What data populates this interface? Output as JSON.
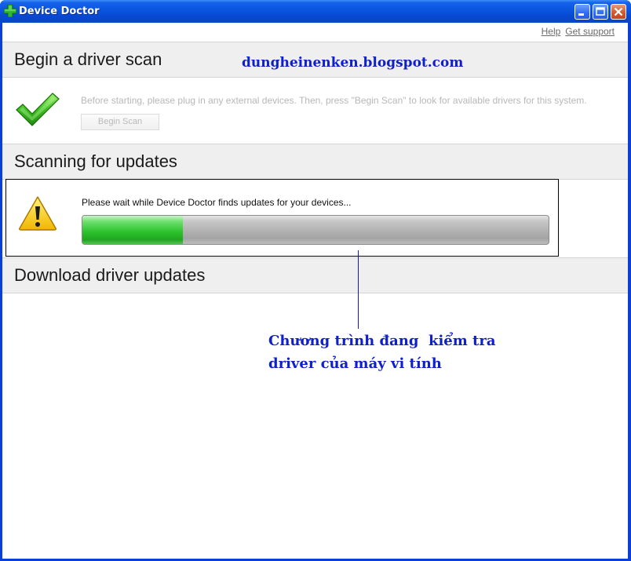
{
  "window": {
    "title": "Device Doctor"
  },
  "toplinks": {
    "help": "Help",
    "get_support": "Get support"
  },
  "watermark": "dungheinenken.blogspot.com",
  "sections": {
    "begin": {
      "title": "Begin a driver scan",
      "description": "Before starting, please plug in any external devices. Then, press \"Begin Scan\" to look for available drivers for this system.",
      "button_label": "Begin Scan"
    },
    "scanning": {
      "title": "Scanning for updates",
      "status": "Please wait while Device Doctor finds updates for your devices...",
      "progress_fraction": 0.215
    },
    "download": {
      "title": "Download driver updates"
    }
  },
  "annotation": {
    "line1": "Chương trình đang  kiểm tra",
    "line2": "driver của máy vi tính"
  },
  "colors": {
    "titlebar": "#0a55e0",
    "progress_green": "#2fc42f",
    "annotation": "#1020c8"
  }
}
